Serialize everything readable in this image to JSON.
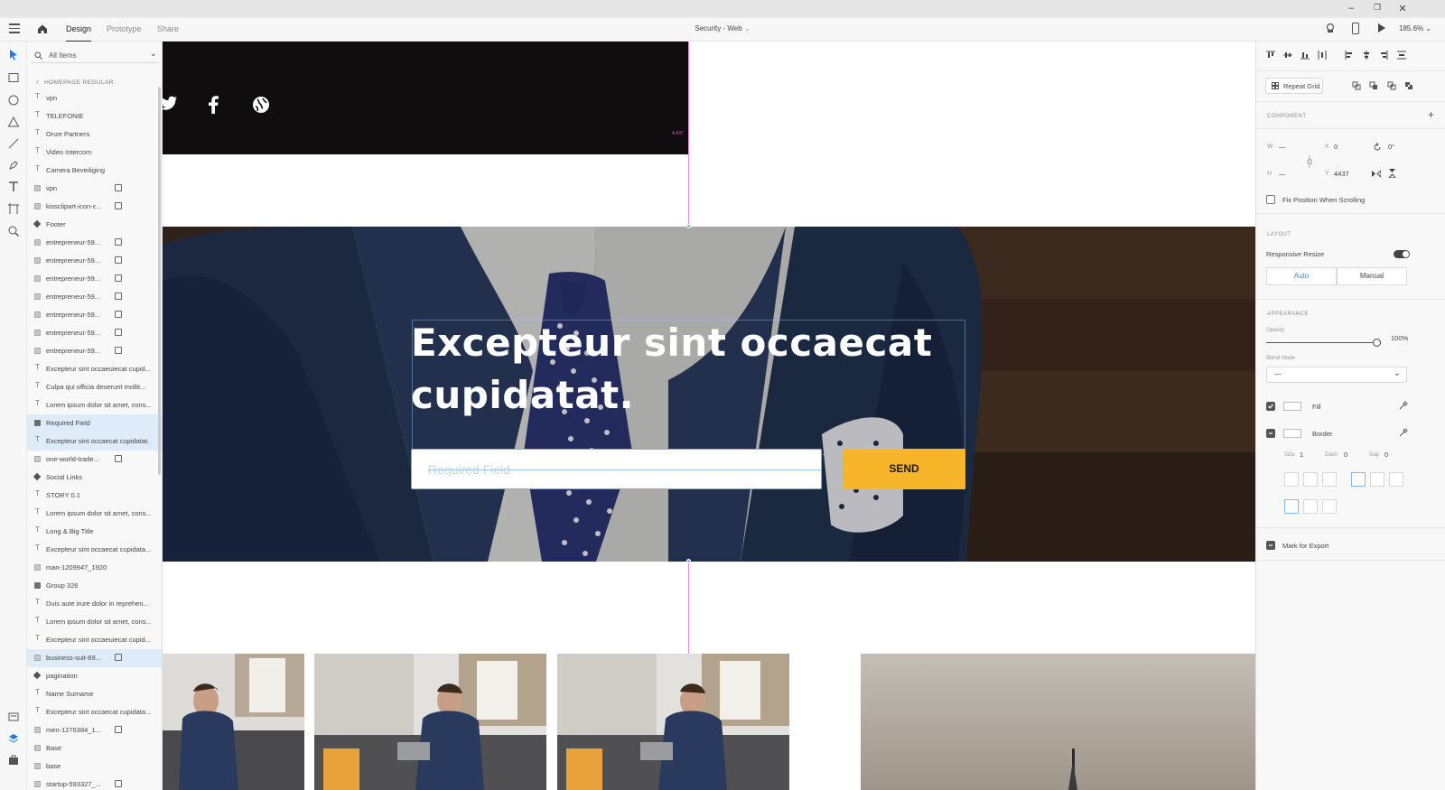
{
  "window": {
    "controls": [
      "–",
      "❐",
      "✕"
    ]
  },
  "menubar": {
    "tabs": [
      "Design",
      "Prototype",
      "Share"
    ],
    "document_title": "Security - Web",
    "zoom": "185.6%"
  },
  "layers": {
    "search_placeholder": "All Items",
    "breadcrumb": "HOMEPAGE REGULAR",
    "items": [
      {
        "type": "text",
        "name": "vpn"
      },
      {
        "type": "text",
        "name": "TELEFONIE"
      },
      {
        "type": "text",
        "name": "Onze Partners"
      },
      {
        "type": "text",
        "name": "Video Intercom"
      },
      {
        "type": "text",
        "name": "Camera Beveiliging"
      },
      {
        "type": "image",
        "name": "vpn",
        "linked": true
      },
      {
        "type": "image",
        "name": "kissclipart-icon-c...",
        "linked": true
      },
      {
        "type": "component",
        "name": "Footer"
      },
      {
        "type": "image",
        "name": "entrepreneur-59...",
        "linked": true
      },
      {
        "type": "image",
        "name": "entrepreneur-59...",
        "linked": true
      },
      {
        "type": "image",
        "name": "entrepreneur-59...",
        "linked": true
      },
      {
        "type": "image",
        "name": "entrepreneur-59...",
        "linked": true
      },
      {
        "type": "image",
        "name": "entrepreneur-59...",
        "linked": true
      },
      {
        "type": "image",
        "name": "entrepreneur-59...",
        "linked": true
      },
      {
        "type": "image",
        "name": "entrepreneur-59...",
        "linked": true
      },
      {
        "type": "text",
        "name": "Excepteur sint occaeuiecat cupid..."
      },
      {
        "type": "text",
        "name": "Culpa qui officia deserunt mollit..."
      },
      {
        "type": "text",
        "name": "Lorem ipsum dolor sit amet, cons..."
      },
      {
        "type": "group",
        "name": "Required Field",
        "selected": true
      },
      {
        "type": "text",
        "name": "Excepteur sint occaecat cupidatat.",
        "selected": true
      },
      {
        "type": "image",
        "name": "one-world-trade...",
        "linked": true
      },
      {
        "type": "component",
        "name": "Social Links"
      },
      {
        "type": "text",
        "name": "STORY 0.1"
      },
      {
        "type": "text",
        "name": "Lorem ipsum dolor sit amet, cons..."
      },
      {
        "type": "text",
        "name": "Long & Big Title"
      },
      {
        "type": "text",
        "name": "Excepteur sint occaecat cupidata..."
      },
      {
        "type": "image",
        "name": "man-1209947_1920"
      },
      {
        "type": "group",
        "name": "Group 326"
      },
      {
        "type": "text",
        "name": "Duis aute irure dolor in reprehen..."
      },
      {
        "type": "text",
        "name": "Lorem ipsum dolor sit amet, cons..."
      },
      {
        "type": "text",
        "name": "Excepteur sint occaeuiecat cupid..."
      },
      {
        "type": "image",
        "name": "business-suit-69...",
        "linked": true,
        "selected": true
      },
      {
        "type": "component",
        "name": "pagination"
      },
      {
        "type": "text",
        "name": "Name Surname"
      },
      {
        "type": "text",
        "name": "Excepteur sint occaecat cupidata..."
      },
      {
        "type": "image",
        "name": "men-1276384_1...",
        "linked": true
      },
      {
        "type": "image",
        "name": "Base"
      },
      {
        "type": "image",
        "name": "base"
      },
      {
        "type": "image",
        "name": "startup-593327_...",
        "linked": true
      }
    ]
  },
  "canvas": {
    "dark_band_label": "4,437",
    "headline": "Excepteur sint occaecat cupidatat.",
    "input_placeholder": "Required Field",
    "send_label": "SEND",
    "accent_color": "#f7b52a",
    "guide_color": "#ff4ad6"
  },
  "inspector": {
    "repeat_grid": "Repeat Grid",
    "component_title": "COMPONENT",
    "w_label": "W",
    "w_value": "—",
    "x_label": "X",
    "x_value": "0",
    "rotation": "0°",
    "h_label": "H",
    "h_value": "—",
    "y_label": "Y",
    "y_value": "4437",
    "fix_position": "Fix Position When Scrolling",
    "layout_title": "LAYOUT",
    "responsive_resize": "Responsive Resize",
    "auto": "Auto",
    "manual": "Manual",
    "appearance_title": "APPEARANCE",
    "opacity_label": "Opacity",
    "opacity_value": "100%",
    "opacity_fraction": 1.0,
    "blend_label": "Blend Mode",
    "blend_value": "—",
    "fill_label": "Fill",
    "border_label": "Border",
    "size_label": "Size",
    "size_value": "1",
    "dash_label": "Dash",
    "dash_value": "0",
    "gap_label": "Gap",
    "gap_value": "0",
    "mark_export": "Mark for Export"
  }
}
